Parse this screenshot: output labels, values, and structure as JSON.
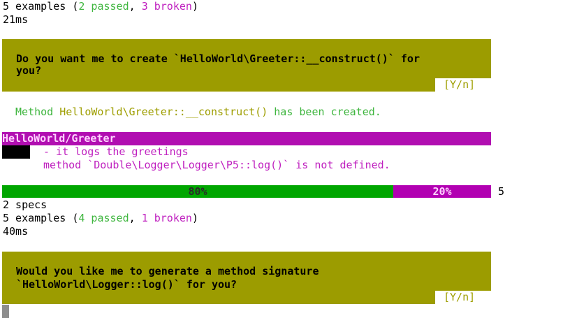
{
  "run1": {
    "summary_prefix": "5 examples (",
    "passed": "2 passed",
    "sep": ", ",
    "broken": "3 broken",
    "summary_suffix": ")",
    "time": "21ms"
  },
  "prompt1": {
    "line1": "Do you want me to create `HelloWorld\\Greeter::__construct()` for",
    "line2": "you?",
    "options": "[Y/n]"
  },
  "created_msg": {
    "prefix": "Method ",
    "method": "HelloWorld\\Greeter::__construct()",
    "suffix": " has been created."
  },
  "spec": {
    "title": "HelloWorld/Greeter",
    "example": "- it logs the greetings",
    "error": "method `Double\\Logger\\Logger\\P5::log()` is not defined."
  },
  "progress": {
    "passed_pct": 80,
    "broken_pct": 20,
    "passed_label": "80%",
    "broken_label": "20%",
    "total": "5"
  },
  "run2": {
    "specs": "2 specs",
    "summary_prefix": "5 examples (",
    "passed": "4 passed",
    "sep": ", ",
    "broken": "1 broken",
    "summary_suffix": ")",
    "time": "40ms"
  },
  "prompt2": {
    "line1": "Would you like me to generate a method signature",
    "line2": "`HelloWorld\\Logger::log()` for you?",
    "options": "[Y/n]"
  },
  "colors": {
    "passed": "#3fb63f",
    "broken": "#bf1fbf",
    "prompt_bg": "#9c9c00",
    "spec_header_bg": "#b10eb1",
    "progress_pass": "#00a600",
    "progress_fail": "#b200b2"
  }
}
